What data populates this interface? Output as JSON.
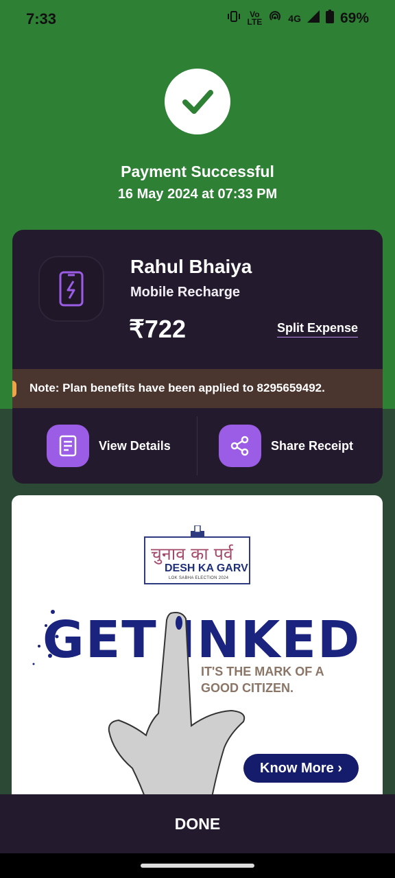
{
  "status_bar": {
    "time": "7:33",
    "volte": "Vo\nLTE",
    "network": "4G",
    "battery": "69%"
  },
  "success": {
    "title": "Payment Successful",
    "datetime": "16 May 2024 at 07:33 PM"
  },
  "payment": {
    "merchant": "Rahul Bhaiya",
    "category": "Mobile Recharge",
    "amount": "₹722",
    "split_label": "Split Expense",
    "note": "Note: Plan benefits have been applied to 8295659492."
  },
  "actions": {
    "view_details": "View Details",
    "share_receipt": "Share Receipt"
  },
  "ad": {
    "hindi_title": "चुनाव का पर्व",
    "subtitle": "DESH KA GARV",
    "small": "LOK SABHA ELECTION 2024",
    "headline": "GET INKED",
    "tagline_1": "IT'S THE MARK OF A",
    "tagline_2": "GOOD CITIZEN.",
    "cta": "Know More ›"
  },
  "footer": {
    "done": "DONE"
  },
  "colors": {
    "success_green": "#2e8035",
    "card_bg": "#241a2e",
    "accent_purple": "#9b5de5"
  }
}
